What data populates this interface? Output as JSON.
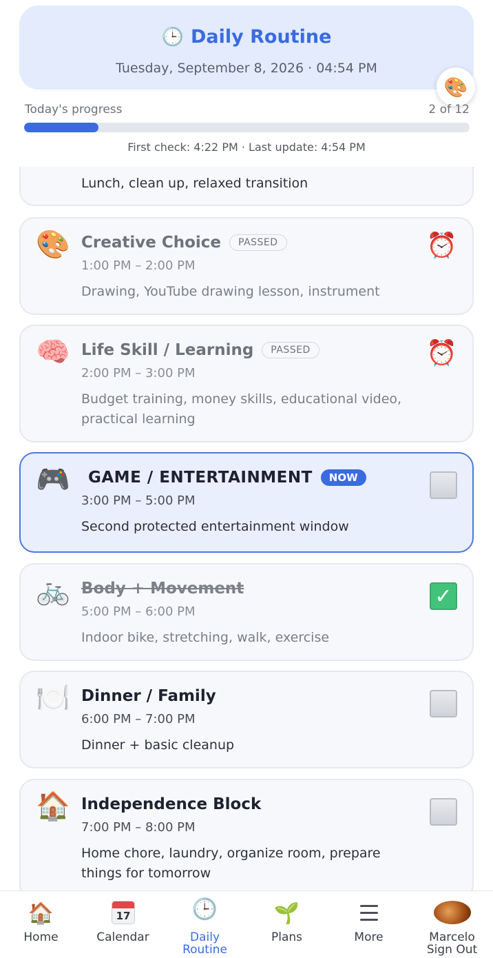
{
  "header": {
    "icon": "clock-icon",
    "title": "Daily Routine",
    "subtitle": "Tuesday, September 8, 2026 · 04:54 PM"
  },
  "theme_button": {
    "icon": "palette-icon",
    "glyph": "🎨"
  },
  "progress": {
    "label": "Today's progress",
    "count_text": "2 of 12",
    "completed": 2,
    "total": 12,
    "meta": "First check: 4:22 PM · Last update: 4:54 PM"
  },
  "colors": {
    "accent": "#3a6be0",
    "done_green": "#43c37a",
    "alarm_red": "#e25454"
  },
  "routine": {
    "partial_item": {
      "desc": "Lunch, clean up, relaxed transition"
    },
    "items": [
      {
        "emoji": "🎨",
        "icon": "palette-icon",
        "title": "Creative Choice",
        "badge": "PASSED",
        "time": "1:00 PM – 2:00 PM",
        "desc": "Drawing, YouTube drawing lesson, instrument",
        "status": "passed",
        "status_icon": "alarm-clock-icon"
      },
      {
        "emoji": "🧠",
        "icon": "brain-icon",
        "title": "Life Skill / Learning",
        "badge": "PASSED",
        "time": "2:00 PM – 3:00 PM",
        "desc": "Budget training, money skills, educational video, practical learning",
        "status": "passed",
        "status_icon": "alarm-clock-icon"
      },
      {
        "emoji": "🎮",
        "icon": "game-controller-icon",
        "title": "GAME / ENTERTAINMENT",
        "badge": "NOW",
        "time": "3:00 PM – 5:00 PM",
        "desc": "Second protected entertainment window",
        "status": "now",
        "status_icon": "checkbox"
      },
      {
        "emoji": "🚲",
        "icon": "bicycle-icon",
        "title": "Body + Movement",
        "badge": "",
        "time": "5:00 PM – 6:00 PM",
        "desc": "Indoor bike, stretching, walk, exercise",
        "status": "done",
        "status_icon": "checkmark-icon"
      },
      {
        "emoji": "🍽️",
        "icon": "plate-icon",
        "title": "Dinner / Family",
        "badge": "",
        "time": "6:00 PM – 7:00 PM",
        "desc": "Dinner + basic cleanup",
        "status": "todo",
        "status_icon": "checkbox"
      },
      {
        "emoji": "🏠",
        "icon": "house-icon",
        "title": "Independence Block",
        "badge": "",
        "time": "7:00 PM – 8:00 PM",
        "desc": "Home chore, laundry, organize room, prepare things for tomorrow",
        "status": "todo",
        "status_icon": "checkbox"
      }
    ]
  },
  "nav": {
    "home": {
      "label": "Home",
      "icon": "house-icon",
      "glyph": "🏠"
    },
    "calendar": {
      "label": "Calendar",
      "icon": "calendar-icon",
      "day": "17"
    },
    "routine": {
      "label": "Daily",
      "label2": "Routine",
      "icon": "clock-icon",
      "glyph": "🕒"
    },
    "plans": {
      "label": "Plans",
      "icon": "seedling-icon",
      "glyph": "🌱"
    },
    "more": {
      "label": "More",
      "icon": "menu-icon"
    },
    "account": {
      "label": "Marcelo",
      "label2": "Sign Out",
      "icon": "avatar-icon"
    }
  }
}
